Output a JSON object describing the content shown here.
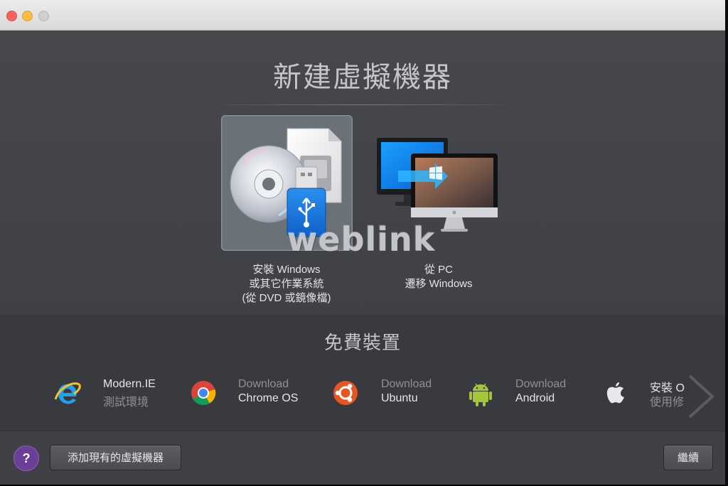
{
  "window": {
    "title_lights": [
      "close",
      "minimize",
      "zoom"
    ]
  },
  "header": {
    "title": "新建虛擬機器"
  },
  "options": [
    {
      "lines": [
        "安裝 Windows",
        "或其它作業系統",
        "(從 DVD 或鏡像檔)"
      ],
      "selected": true
    },
    {
      "lines": [
        "從 PC",
        "遷移 Windows"
      ],
      "selected": false
    }
  ],
  "watermark": "weblink",
  "free_section": {
    "title": "免費裝置",
    "items": [
      {
        "line1": "Modern.IE",
        "line2": "測試環境",
        "icon": "internet-explorer-icon"
      },
      {
        "line1": "Download",
        "line2": "Chrome OS",
        "icon": "chrome-icon"
      },
      {
        "line1": "Download",
        "line2": "Ubuntu",
        "icon": "ubuntu-icon"
      },
      {
        "line1": "Download",
        "line2": "Android",
        "icon": "android-icon"
      },
      {
        "line1": "安裝 O",
        "line2": "使用修",
        "icon": "apple-icon"
      }
    ]
  },
  "footer": {
    "help_label": "?",
    "add_existing_label": "添加現有的虛擬機器",
    "continue_label": "繼續"
  },
  "colors": {
    "background": "#44464c",
    "free_section_bg": "#393a3f",
    "selected_tile": "#6a7177",
    "help_button": "#6b3f99"
  }
}
